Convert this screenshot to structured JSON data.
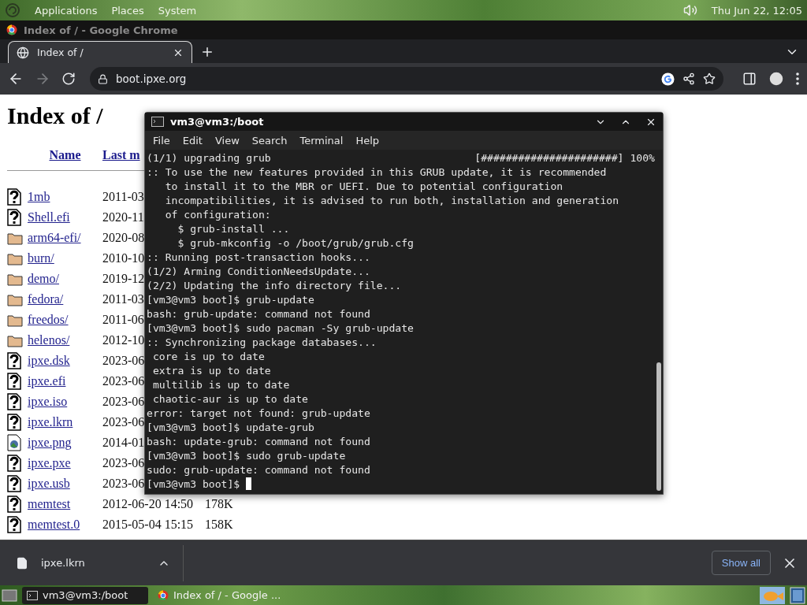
{
  "desktop_panel": {
    "menus": [
      "Applications",
      "Places",
      "System"
    ],
    "clock": "Thu Jun 22, 12:05"
  },
  "browser": {
    "window_title": "Index of / - Google Chrome",
    "tabs": [
      {
        "label": "Index of /",
        "selected": true
      }
    ],
    "navigation": {
      "back_disabled": false,
      "forward_disabled": true
    },
    "address": "boot.ipxe.org",
    "page": {
      "heading": "Index of /",
      "columns": [
        "Name",
        "Last m"
      ],
      "rows": [
        {
          "kind": "file",
          "name": "1mb",
          "modified": "2011-03"
        },
        {
          "kind": "file",
          "name": "Shell.efi",
          "modified": "2020-11"
        },
        {
          "kind": "folder",
          "name": "arm64-efi/",
          "modified": "2020-08"
        },
        {
          "kind": "folder",
          "name": "burn/",
          "modified": "2010-10"
        },
        {
          "kind": "folder",
          "name": "demo/",
          "modified": "2019-12"
        },
        {
          "kind": "folder",
          "name": "fedora/",
          "modified": "2011-03"
        },
        {
          "kind": "folder",
          "name": "freedos/",
          "modified": "2011-06"
        },
        {
          "kind": "folder",
          "name": "helenos/",
          "modified": "2012-10"
        },
        {
          "kind": "file",
          "name": "ipxe.dsk",
          "modified": "2023-06"
        },
        {
          "kind": "file",
          "name": "ipxe.efi",
          "modified": "2023-06"
        },
        {
          "kind": "file",
          "name": "ipxe.iso",
          "modified": "2023-06"
        },
        {
          "kind": "file",
          "name": "ipxe.lkrn",
          "modified": "2023-06"
        },
        {
          "kind": "image",
          "name": "ipxe.png",
          "modified": "2014-01"
        },
        {
          "kind": "file",
          "name": "ipxe.pxe",
          "modified": "2023-06"
        },
        {
          "kind": "file",
          "name": "ipxe.usb",
          "modified": "2023-06"
        },
        {
          "kind": "file",
          "name": "memtest",
          "modified": "2012-06-20 14:50",
          "size": "178K"
        },
        {
          "kind": "file",
          "name": "memtest.0",
          "modified": "2015-05-04 15:15",
          "size": "158K"
        }
      ]
    },
    "downloads": {
      "items": [
        {
          "name": "ipxe.lkrn"
        }
      ],
      "show_all": "Show all"
    }
  },
  "terminal": {
    "title": "vm3@vm3:/boot",
    "menu": [
      "File",
      "Edit",
      "View",
      "Search",
      "Terminal",
      "Help"
    ],
    "lines": [
      {
        "kind": "progress",
        "text": "(1/1) upgrading grub",
        "bar": "[######################]",
        "percent": "100%"
      },
      {
        "kind": "text",
        "text": ":: To use the new features provided in this GRUB update, it is recommended"
      },
      {
        "kind": "text",
        "text": "   to install it to the MBR or UEFI. Due to potential configuration"
      },
      {
        "kind": "text",
        "text": "   incompatibilities, it is advised to run both, installation and generation"
      },
      {
        "kind": "text",
        "text": "   of configuration:"
      },
      {
        "kind": "text",
        "text": "     $ grub-install ..."
      },
      {
        "kind": "text",
        "text": "     $ grub-mkconfig -o /boot/grub/grub.cfg"
      },
      {
        "kind": "text",
        "text": ":: Running post-transaction hooks..."
      },
      {
        "kind": "text",
        "text": "(1/2) Arming ConditionNeedsUpdate..."
      },
      {
        "kind": "text",
        "text": "(2/2) Updating the info directory file..."
      },
      {
        "kind": "text",
        "text": "[vm3@vm3 boot]$ grub-update"
      },
      {
        "kind": "text",
        "text": "bash: grub-update: command not found"
      },
      {
        "kind": "text",
        "text": "[vm3@vm3 boot]$ sudo pacman -Sy grub-update"
      },
      {
        "kind": "text",
        "text": ":: Synchronizing package databases..."
      },
      {
        "kind": "text",
        "text": " core is up to date"
      },
      {
        "kind": "text",
        "text": " extra is up to date"
      },
      {
        "kind": "text",
        "text": " multilib is up to date"
      },
      {
        "kind": "text",
        "text": " chaotic-aur is up to date"
      },
      {
        "kind": "text",
        "text": "error: target not found: grub-update"
      },
      {
        "kind": "text",
        "text": "[vm3@vm3 boot]$ update-grub"
      },
      {
        "kind": "text",
        "text": "bash: update-grub: command not found"
      },
      {
        "kind": "text",
        "text": "[vm3@vm3 boot]$ sudo grub-update"
      },
      {
        "kind": "text",
        "text": "sudo: grub-update: command not found"
      },
      {
        "kind": "prompt",
        "text": "[vm3@vm3 boot]$",
        "cursor": true
      }
    ]
  },
  "taskbar": {
    "items": [
      {
        "kind": "terminal",
        "label": "vm3@vm3:/boot",
        "selected": true
      },
      {
        "kind": "browser",
        "label": "Index of / - Google ...",
        "selected": false
      }
    ]
  }
}
